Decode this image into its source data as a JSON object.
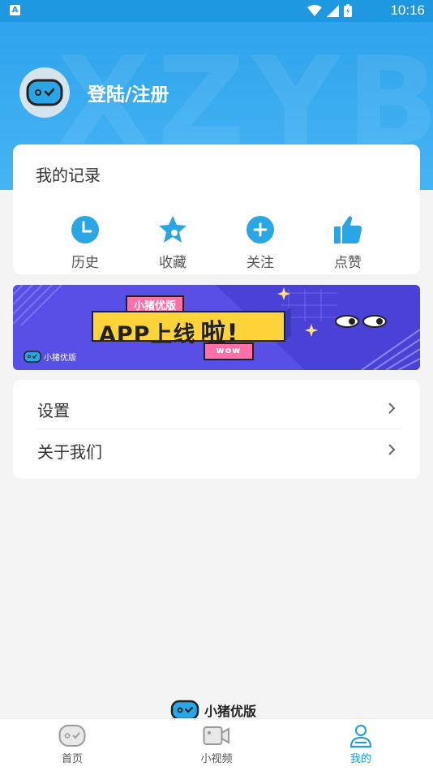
{
  "status_bar": {
    "time": "10:16",
    "app_badge": "A"
  },
  "header": {
    "watermark": "XZYB",
    "login_label": "登陆/注册"
  },
  "records": {
    "title": "我的记录",
    "items": [
      {
        "label": "历史",
        "icon": "clock-icon"
      },
      {
        "label": "收藏",
        "icon": "star-icon"
      },
      {
        "label": "关注",
        "icon": "plus-circle-icon"
      },
      {
        "label": "点赞",
        "icon": "thumbs-up-icon"
      }
    ]
  },
  "banner": {
    "tag": "小猪优版",
    "headline": "APP上线",
    "exclaim": "啦!",
    "sub": "wow",
    "brand": "小猪优版"
  },
  "menu": {
    "items": [
      {
        "label": "设置"
      },
      {
        "label": "关于我们"
      }
    ]
  },
  "footer_brand": "小猪优版",
  "tabbar": {
    "tabs": [
      {
        "label": "首页",
        "active": false
      },
      {
        "label": "小视频",
        "active": false
      },
      {
        "label": "我的",
        "active": true
      }
    ]
  },
  "colors": {
    "primary": "#1f98e2",
    "accent": "#2ba6e5",
    "banner_bg": "#5850e6",
    "banner_yellow": "#ffd43b",
    "banner_pink": "#ff6fa8"
  }
}
